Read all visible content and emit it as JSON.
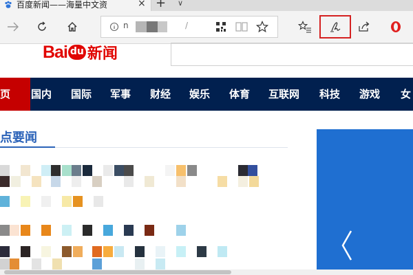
{
  "tab": {
    "title": "百度新闻——海量中文资"
  },
  "toolbar": {
    "address": "n",
    "address_slash": "/"
  },
  "logo": {
    "bai": "Bai",
    "du": "du",
    "news": "新闻"
  },
  "nav": {
    "items": [
      {
        "label": "页",
        "active": true
      },
      {
        "label": "国内"
      },
      {
        "label": "国际"
      },
      {
        "label": "军事"
      },
      {
        "label": "财经"
      },
      {
        "label": "娱乐"
      },
      {
        "label": "体育"
      },
      {
        "label": "互联网"
      },
      {
        "label": "科技"
      },
      {
        "label": "游戏"
      },
      {
        "label": "女"
      }
    ]
  },
  "headlines": {
    "title": "点要闻"
  },
  "colors": {
    "nav_bg": "#01204f",
    "nav_active": "#c50000",
    "accent_blue": "#2a62b8",
    "brand_red": "#e10602",
    "highlight": "#d42020",
    "carousel_bg": "#1f6fd1"
  }
}
